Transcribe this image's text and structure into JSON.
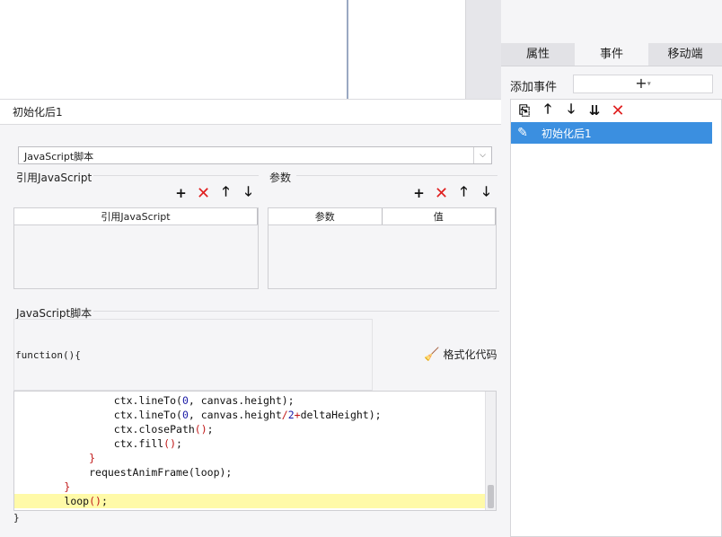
{
  "right_panel": {
    "tabs": [
      {
        "label": "属性",
        "active": false
      },
      {
        "label": "事件",
        "active": true
      },
      {
        "label": "移动端",
        "active": false
      }
    ],
    "add_event_label": "添加事件",
    "add_event_button": "+",
    "events": [
      {
        "label": "初始化后1",
        "selected": true
      }
    ]
  },
  "editor": {
    "section_title": "初始化后1",
    "script_type": "JavaScript脚本",
    "ref_group_label": "引用JavaScript",
    "ref_table_headers": [
      "引用JavaScript"
    ],
    "param_group_label": "参数",
    "param_table_headers": [
      "参数",
      "值"
    ],
    "js_group_label": "JavaScript脚本",
    "function_header": "function(){",
    "format_button": "格式化代码",
    "closing_brace": "}",
    "code_lines": [
      {
        "indent": 16,
        "tokens": [
          [
            "t",
            "ctx.lineTo("
          ],
          [
            "n",
            "0"
          ],
          [
            "t",
            ", canvas.height);"
          ]
        ]
      },
      {
        "indent": 16,
        "tokens": [
          [
            "t",
            "ctx.lineTo("
          ],
          [
            "n",
            "0"
          ],
          [
            "t",
            ", canvas.height"
          ],
          [
            "p",
            "/"
          ],
          [
            "n",
            "2"
          ],
          [
            "p",
            "+"
          ],
          [
            "t",
            "deltaHeight);"
          ]
        ]
      },
      {
        "indent": 16,
        "tokens": [
          [
            "t",
            "ctx.closePath"
          ],
          [
            "p",
            "()"
          ],
          [
            "t",
            ";"
          ]
        ]
      },
      {
        "indent": 16,
        "tokens": [
          [
            "t",
            "ctx.fill"
          ],
          [
            "p",
            "()"
          ],
          [
            "t",
            ";"
          ]
        ]
      },
      {
        "indent": 12,
        "tokens": [
          [
            "p",
            "}"
          ]
        ]
      },
      {
        "indent": 12,
        "tokens": [
          [
            "t",
            "requestAnimFrame(loop);"
          ]
        ]
      },
      {
        "indent": 8,
        "tokens": [
          [
            "p",
            "}"
          ]
        ]
      },
      {
        "indent": 8,
        "tokens": [
          [
            "t",
            "loop"
          ],
          [
            "p",
            "()"
          ],
          [
            "t",
            ";"
          ]
        ],
        "highlight": true
      }
    ]
  },
  "icons": {
    "add": "+",
    "delete": "✕",
    "move_up": "🡑",
    "move_down": "🡓",
    "copy": "⎘",
    "sort": "⇊",
    "edit": "✎",
    "dropdown": "▾",
    "broom": "🧹"
  },
  "colors": {
    "selection": "#3b8fe0",
    "delete_red": "#e02020",
    "line_highlight": "#fffaa8"
  }
}
